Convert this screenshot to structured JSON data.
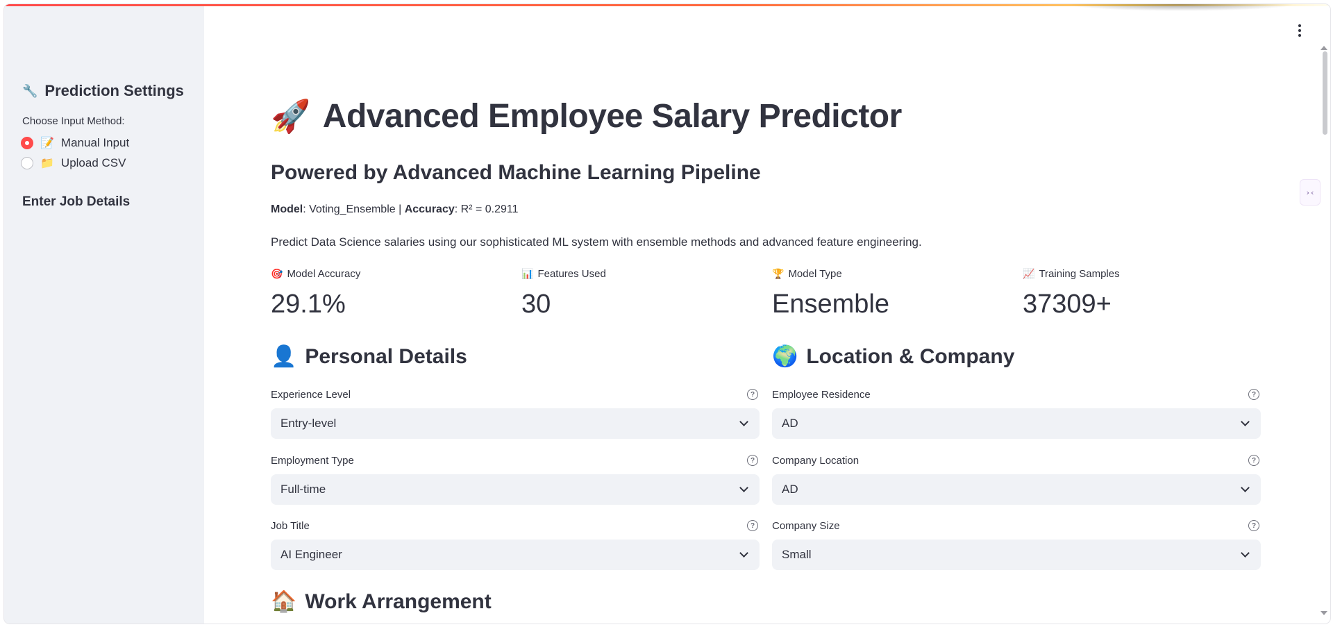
{
  "sidebar": {
    "title": "Prediction Settings",
    "title_icon": "🔧",
    "input_method_label": "Choose Input Method:",
    "options": [
      {
        "icon": "📝",
        "label": "Manual Input",
        "selected": true
      },
      {
        "icon": "📁",
        "label": "Upload CSV",
        "selected": false
      }
    ],
    "section": "Enter Job Details"
  },
  "header": {
    "icon": "🚀",
    "title": "Advanced Employee Salary Predictor",
    "subtitle": "Powered by Advanced Machine Learning Pipeline",
    "model_label": "Model",
    "model_value": ": Voting_Ensemble | ",
    "accuracy_label": "Accuracy",
    "accuracy_value": ": R² = 0.2911",
    "description": "Predict Data Science salaries using our sophisticated ML system with ensemble methods and advanced feature engineering."
  },
  "metrics": [
    {
      "icon": "🎯",
      "label": "Model Accuracy",
      "value": "29.1%"
    },
    {
      "icon": "📊",
      "label": "Features Used",
      "value": "30"
    },
    {
      "icon": "🏆",
      "label": "Model Type",
      "value": "Ensemble"
    },
    {
      "icon": "📈",
      "label": "Training Samples",
      "value": "37309+"
    }
  ],
  "sections": {
    "personal": {
      "icon": "👤",
      "title": "Personal Details"
    },
    "location": {
      "icon": "🌍",
      "title": "Location & Company"
    },
    "work": {
      "icon": "🏠",
      "title": "Work Arrangement"
    }
  },
  "fields": {
    "experience_level": {
      "label": "Experience Level",
      "value": "Entry-level"
    },
    "employment_type": {
      "label": "Employment Type",
      "value": "Full-time"
    },
    "job_title": {
      "label": "Job Title",
      "value": "AI Engineer"
    },
    "employee_residence": {
      "label": "Employee Residence",
      "value": "AD"
    },
    "company_location": {
      "label": "Company Location",
      "value": "AD"
    },
    "company_size": {
      "label": "Company Size",
      "value": "Small"
    }
  },
  "help_glyph": "?",
  "side_badge": "›‹",
  "colors": {
    "accent": "#ff4b4b",
    "sidebar_bg": "#f0f2f6",
    "text": "#31333f"
  }
}
